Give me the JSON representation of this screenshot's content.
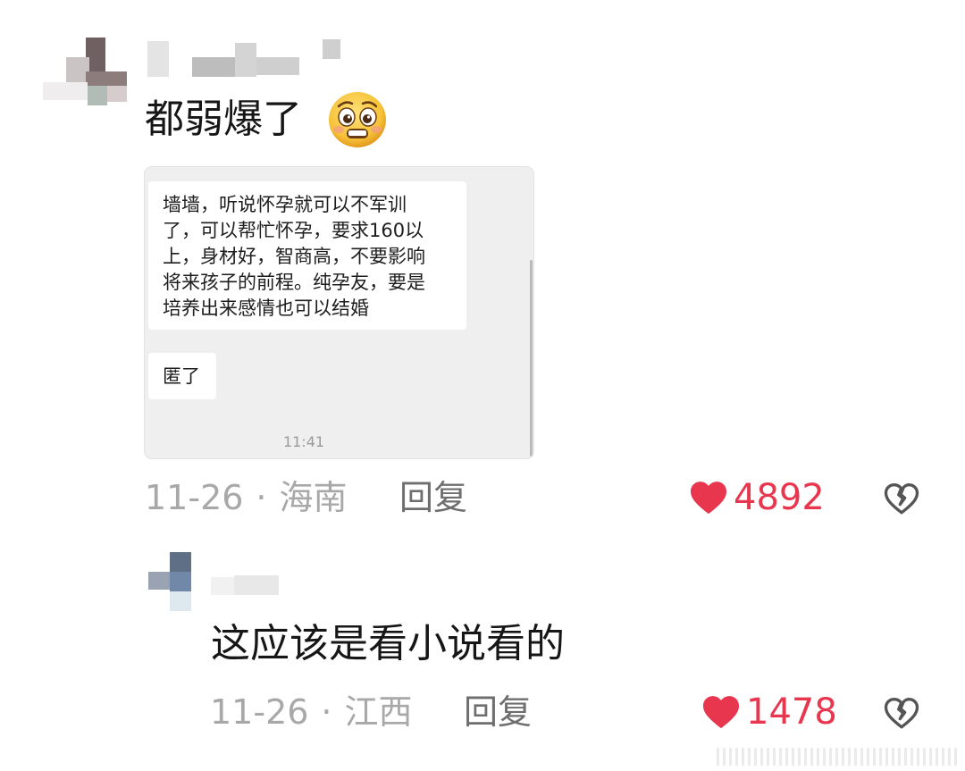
{
  "comments": [
    {
      "text": "都弱爆了",
      "emoji": "pleading-face-emoji",
      "embedded_chat": {
        "message1_lines": [
          "墙墙，听说怀孕就可以不军训",
          "了，可以帮忙怀孕，要求160以",
          "上，身材好，智商高，不要影响",
          "将来孩子的前程。纯孕友，要是",
          "培养出来感情也可以结婚"
        ],
        "message2": "匿了",
        "time": "11:41"
      },
      "date": "11-26",
      "separator": "·",
      "location": "海南",
      "reply_label": "回复",
      "likes": "4892"
    },
    {
      "text": "这应该是看小说看的",
      "date": "11-26",
      "separator": "·",
      "location": "江西",
      "reply_label": "回复",
      "likes": "1478"
    }
  ],
  "colors": {
    "like": "#e8364f",
    "meta": "#a8a8a8",
    "reply": "#6e6e6e",
    "text": "#161616"
  },
  "icons": [
    "heart-icon",
    "broken-heart-icon",
    "pleading-face-emoji"
  ]
}
